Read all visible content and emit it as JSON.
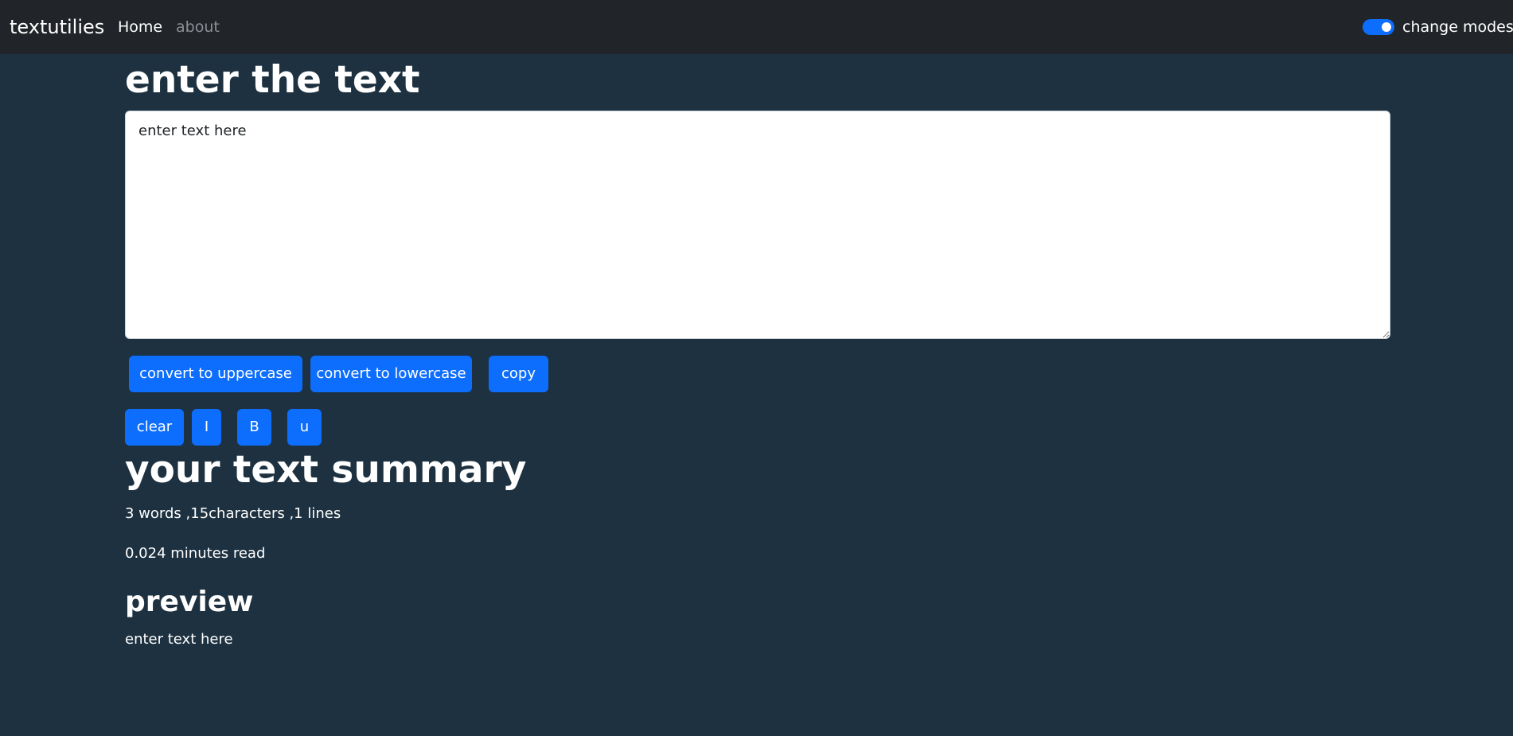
{
  "navbar": {
    "brand": "textutilies",
    "links": [
      {
        "label": "Home",
        "active": true
      },
      {
        "label": "about",
        "active": false
      }
    ],
    "mode_toggle": {
      "label": "change modes",
      "checked": true
    }
  },
  "form": {
    "heading": "enter the text",
    "textarea_value": "",
    "textarea_placeholder": "enter text here"
  },
  "buttons": {
    "uppercase": "convert to uppercase",
    "lowercase": "convert to lowercase",
    "copy": "copy",
    "clear": "clear",
    "italic": "I",
    "bold": "B",
    "underline": "u"
  },
  "summary": {
    "heading": "your text summary",
    "counts": "3 words ,15characters ,1 lines",
    "read_time": "0.024 minutes read"
  },
  "preview": {
    "heading": "preview",
    "text": "enter text here"
  },
  "colors": {
    "page_background": "#1d3140",
    "navbar_background": "#212529",
    "accent": "#0d6efd",
    "muted_link": "#8c9095"
  }
}
